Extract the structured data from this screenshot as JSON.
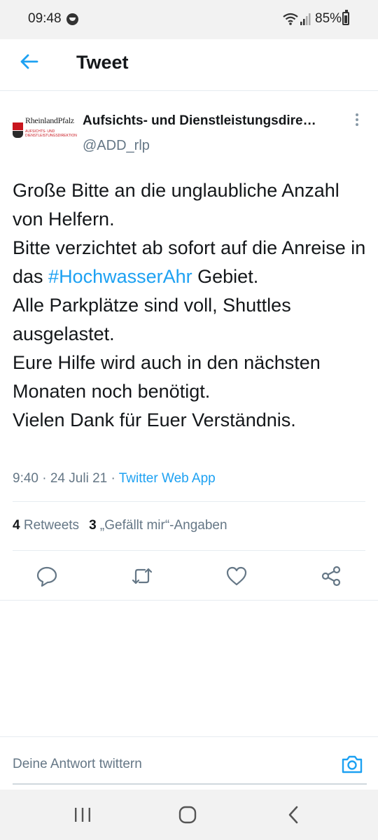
{
  "status_bar": {
    "time": "09:48",
    "battery": "85%"
  },
  "header": {
    "title": "Tweet"
  },
  "author": {
    "logo_name": "RheinlandPfalz",
    "logo_sub": "AUFSICHTS- UND DIENSTLEISTUNGSDIREKTION",
    "name": "Aufsichts- und Dienstleistungsdire…",
    "handle": "@ADD_rlp"
  },
  "tweet": {
    "line1": "Große Bitte an die unglaubliche Anzahl von Helfern.",
    "line2": "Bitte verzichtet ab sofort auf die Anreise in das ",
    "hashtag": "#HochwasserAhr",
    "line2_end": " Gebiet.",
    "line3": "Alle Parkplätze sind voll, Shuttles ausgelastet.",
    "line4": "Eure Hilfe wird auch in den nächsten Monaten noch benötigt.",
    "line5": "Vielen Dank für Euer Verständnis."
  },
  "meta": {
    "timestamp": "9:40 · 24 Juli 21 · ",
    "source": "Twitter Web App"
  },
  "stats": {
    "retweet_count": "4",
    "retweet_label": "Retweets",
    "like_count": "3",
    "like_label": "„Gefällt mir“-Angaben"
  },
  "actions": {
    "reply_icon": "comment-icon",
    "retweet_icon": "retweet-icon",
    "like_icon": "heart-icon",
    "share_icon": "share-icon"
  },
  "reply": {
    "placeholder": "Deine Antwort twittern"
  },
  "colors": {
    "accent": "#1da1f2",
    "text": "#14171a",
    "secondary": "#657786"
  }
}
